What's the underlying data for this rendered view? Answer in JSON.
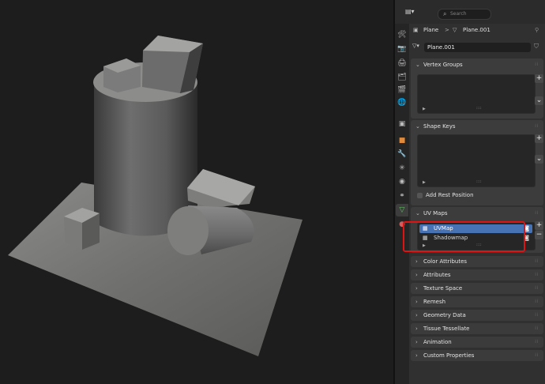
{
  "header": {
    "search_placeholder": "Search",
    "search_icon": "search-icon",
    "editor_type_icon": "properties-editor-icon"
  },
  "breadcrumb": {
    "object_name": "Plane",
    "separator": ">",
    "mesh_name": "Plane.001"
  },
  "datablock": {
    "mesh_name": "Plane.001"
  },
  "tabs": [
    {
      "name": "tool-icon",
      "glyph": "🛠"
    },
    {
      "name": "render-icon",
      "glyph": "📷"
    },
    {
      "name": "output-icon",
      "glyph": "🖨"
    },
    {
      "name": "view-layer-icon",
      "glyph": "🗂"
    },
    {
      "name": "scene-icon",
      "glyph": "🎬"
    },
    {
      "name": "world-icon",
      "glyph": "🌐"
    },
    {
      "name": "collection-icon",
      "glyph": "▣"
    },
    {
      "name": "object-icon",
      "glyph": "■"
    },
    {
      "name": "modifier-icon",
      "glyph": "🔧"
    },
    {
      "name": "particles-icon",
      "glyph": "✳"
    },
    {
      "name": "physics-icon",
      "glyph": "◉"
    },
    {
      "name": "constraints-icon",
      "glyph": "⚭"
    },
    {
      "name": "mesh-data-icon",
      "glyph": "▽"
    },
    {
      "name": "material-icon",
      "glyph": "●"
    }
  ],
  "panels": {
    "vertex_groups": "Vertex Groups",
    "shape_keys": "Shape Keys",
    "add_rest_position": "Add Rest Position",
    "uv_maps": "UV Maps",
    "uv_map_items": [
      {
        "name": "UVMap",
        "selected": true
      },
      {
        "name": "Shadowmap",
        "selected": false
      }
    ],
    "collapsed": [
      "Color Attributes",
      "Attributes",
      "Texture Space",
      "Remesh",
      "Geometry Data",
      "Tissue Tessellate",
      "Animation",
      "Custom Properties"
    ]
  },
  "colors": {
    "accent": "#4772b3",
    "highlight_box": "#e01313",
    "panel_bg": "#3c3c3c",
    "editor_bg": "#303030",
    "viewport_bg": "#1d1d1d"
  }
}
